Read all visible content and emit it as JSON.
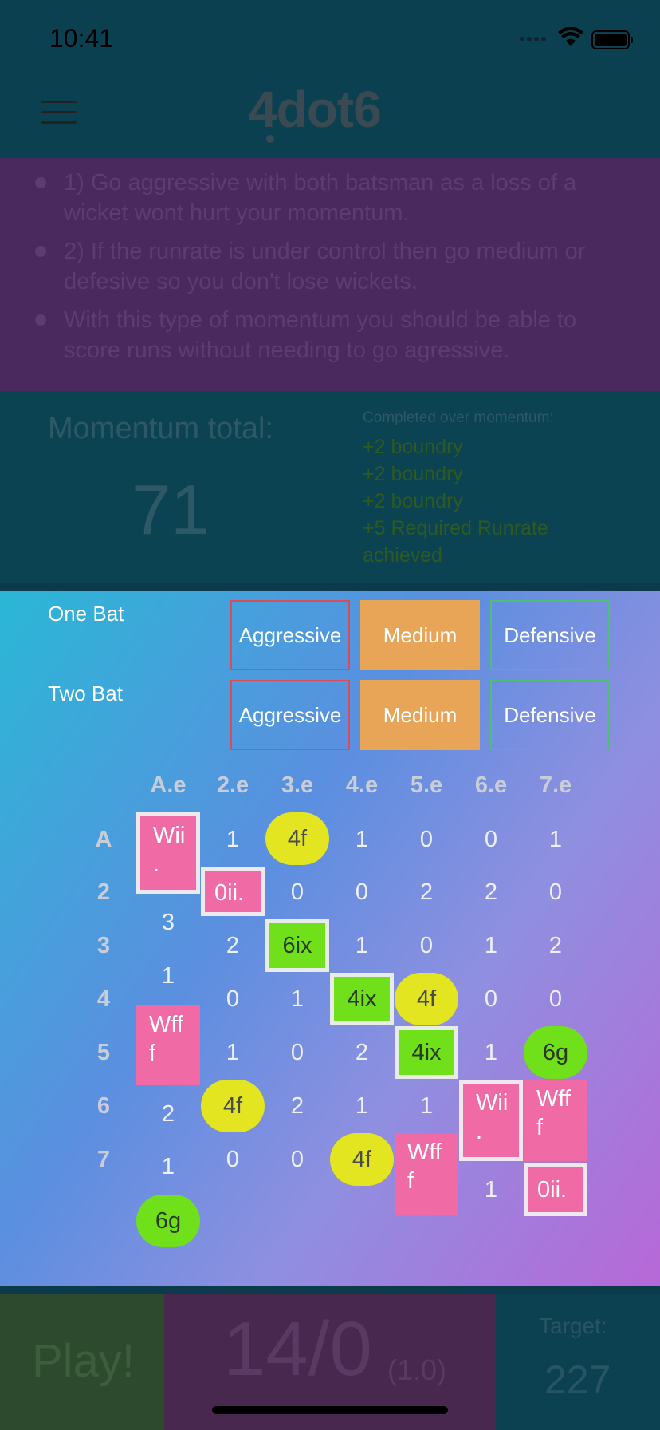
{
  "status": {
    "time": "10:41"
  },
  "header": {
    "logo": "4dot6"
  },
  "tips": [
    "1) Go aggressive with both batsman as a loss of a wicket wont hurt your momentum.",
    "2) If the runrate is under control then go medium or defesive so you don't lose wickets.",
    "With this type of momentum you should be able to score runs without needing to go agressive."
  ],
  "momentum": {
    "title": "Momentum total:",
    "value": "71",
    "completed_title": "Completed over momentum:",
    "completed": [
      "+2 boundry",
      "+2 boundry",
      "+2 boundry",
      "+5 Required Runrate achieved"
    ]
  },
  "modes": {
    "one_bat": "One Bat",
    "two_bat": "Two Bat",
    "aggressive": "Aggressive",
    "medium": "Medium",
    "defensive": "Defensive"
  },
  "grid": {
    "cols": [
      "A.e",
      "2.e",
      "3.e",
      "4.e",
      "5.e",
      "6.e",
      "7.e"
    ],
    "rows": [
      "A",
      "2",
      "3",
      "4",
      "5",
      "6",
      "7"
    ],
    "cells": {
      "r1": [
        "Wii .",
        "1",
        "4f",
        "1",
        "0",
        "0",
        "1"
      ],
      "r2": [
        "0ii.",
        "0",
        "0",
        "2",
        "2",
        "0"
      ],
      "r3": [
        "3",
        "2",
        "6ix",
        "1",
        "0",
        "1",
        "2"
      ],
      "r4": [
        "1",
        "0",
        "1",
        "4ix",
        "4f",
        "0",
        "0"
      ],
      "r5": [
        "Wff f",
        "1",
        "0",
        "2",
        "4ix",
        "1",
        "6g"
      ],
      "r6": [
        "2",
        "4f",
        "2",
        "1",
        "1",
        "Wii .",
        "Wff f"
      ],
      "r7": [
        "1",
        "0",
        "0",
        "4f",
        "Wff f",
        "1",
        "0ii."
      ],
      "r8": [
        "6g"
      ]
    }
  },
  "bottom": {
    "play": "Play!",
    "score": "14/0",
    "overs": "(1.0)",
    "target_label": "Target:",
    "target_value": "227"
  }
}
